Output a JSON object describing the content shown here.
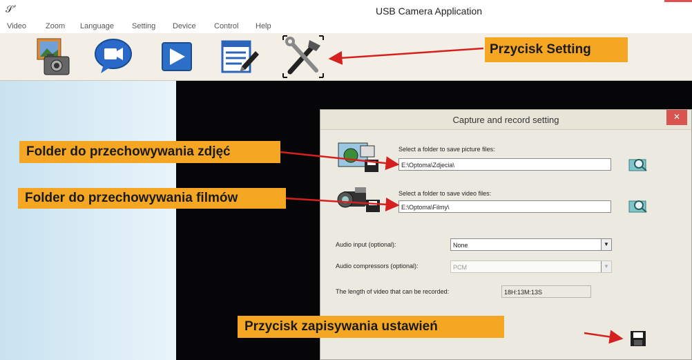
{
  "window": {
    "title": "USB Camera Application",
    "icon": "app-icon-glyph",
    "icon_glyph": "𝒮ʼ"
  },
  "menu": [
    "Video",
    "Zoom",
    "Language",
    "Setting",
    "Device",
    "Control",
    "Help"
  ],
  "toolbar": {
    "buttons": [
      {
        "name": "snapshot",
        "icon": "photo-camera-icon"
      },
      {
        "name": "record",
        "icon": "video-camera-icon"
      },
      {
        "name": "play",
        "icon": "play-icon"
      },
      {
        "name": "edit",
        "icon": "edit-list-icon"
      },
      {
        "name": "setting",
        "icon": "tools-icon"
      }
    ]
  },
  "annotations": {
    "setting": "Przycisk Setting",
    "picture_folder": "Folder do przechowywania zdjęć",
    "video_folder": "Folder do przechowywania filmów",
    "save_button": "Przycisk zapisywania ustawień"
  },
  "dialog": {
    "title": "Capture and record setting",
    "close_glyph": "✕",
    "picture_label": "Select a folder to save picture files:",
    "picture_path": "E:\\Optoma\\Zdjecia\\",
    "video_label": "Select a folder to save video files:",
    "video_path": "E:\\Optoma\\Filmy\\",
    "audio_input_label": "Audio input (optional):",
    "audio_input_value": "None",
    "audio_compressor_label": "Audio compressors (optional):",
    "audio_compressor_value": "PCM",
    "length_label": "The length of video that can be recorded:",
    "length_value": "18H:13M:13S"
  },
  "colors": {
    "callout": "#f5a623",
    "arrow": "#d62020",
    "toolbar_bg": "#f3efe6",
    "dialog_bg": "#ece9e0",
    "video_area": "#060608"
  }
}
